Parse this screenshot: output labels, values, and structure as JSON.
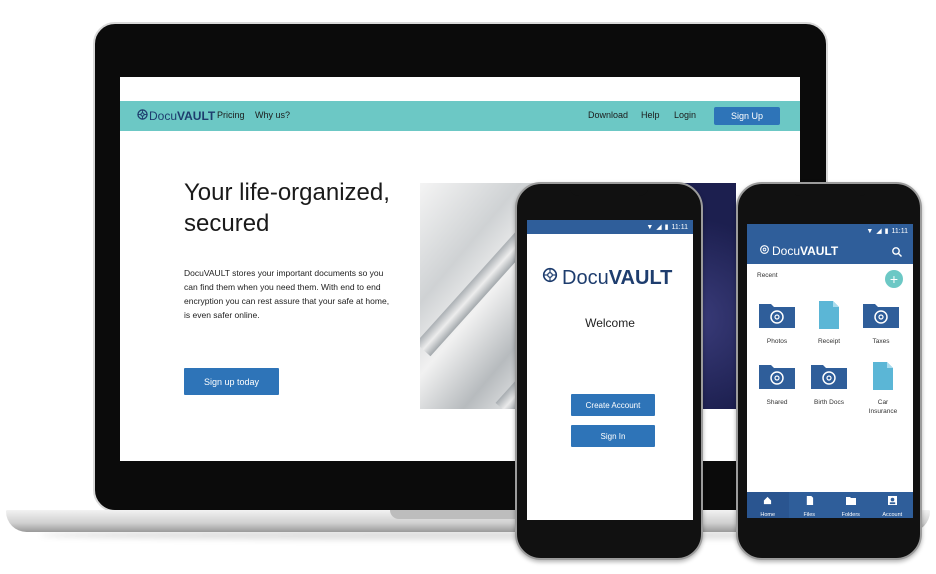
{
  "site": {
    "logo_light": "Docu",
    "logo_bold": "VAULT",
    "nav_left": [
      "Pricing",
      "Why us?"
    ],
    "nav_right": [
      "Download",
      "Help",
      "Login"
    ],
    "signup_label": "Sign Up",
    "hero_title": "Your life-organized, secured",
    "hero_body": "DocuVAULT stores your important documents so you can find them when you need them.  With end to end encryption you can rest assure that your safe at home, is even safer online.",
    "cta_label": "Sign up today",
    "colors": {
      "nav": "#6cc8c5",
      "primary": "#2e74b8",
      "logo": "#1e3d6e"
    }
  },
  "phone1": {
    "time": "11:11",
    "logo_light": "Docu",
    "logo_bold": "VAULT",
    "welcome": "Welcome",
    "create_account": "Create Account",
    "sign_in": "Sign In"
  },
  "phone2": {
    "time": "11:11",
    "logo_light": "Docu",
    "logo_bold": "VAULT",
    "recent_label": "Recent",
    "fab": "+",
    "tiles": [
      {
        "label": "Photos",
        "kind": "folder"
      },
      {
        "label": "Receipt",
        "kind": "file"
      },
      {
        "label": "Taxes",
        "kind": "folder"
      },
      {
        "label": "Shared",
        "kind": "folder"
      },
      {
        "label": "Birth Docs",
        "kind": "folder"
      },
      {
        "label": "Car Insurance",
        "kind": "file"
      }
    ],
    "tabs": [
      {
        "label": "Home",
        "icon": "home-icon"
      },
      {
        "label": "Files",
        "icon": "files-icon"
      },
      {
        "label": "Folders",
        "icon": "folders-icon"
      },
      {
        "label": "Account",
        "icon": "account-icon"
      }
    ],
    "colors": {
      "header": "#2f5e9a",
      "folder": "#2f5e9a",
      "file": "#5bb6d6",
      "fab": "#6cc8c5"
    }
  }
}
